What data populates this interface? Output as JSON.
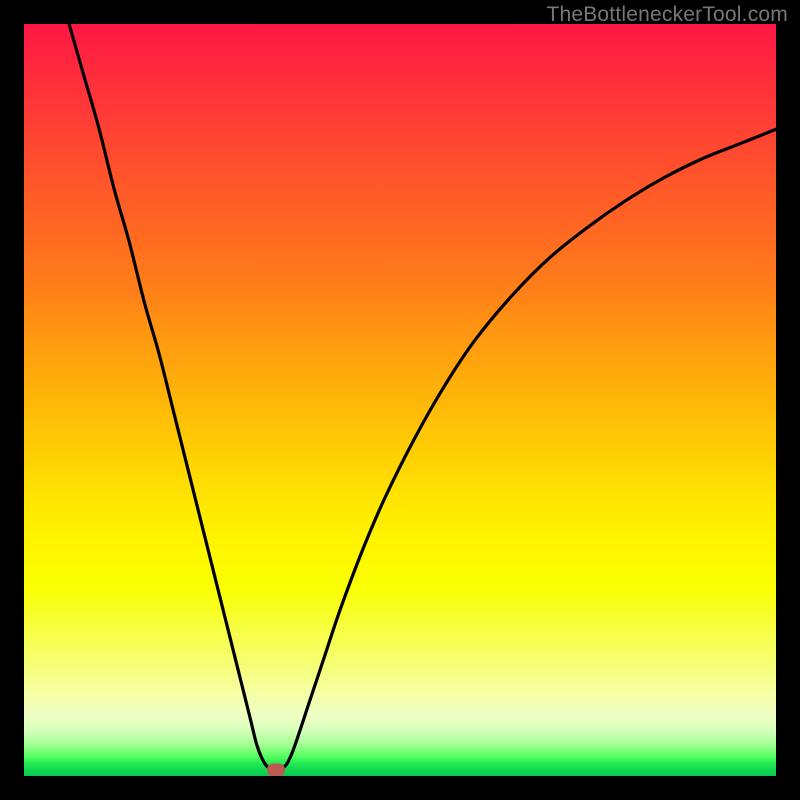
{
  "watermark": "TheBottleneckerTool.com",
  "colors": {
    "frame": "#000000",
    "curve": "#000000",
    "marker": "#bb5b4e",
    "gradient_top": "#ff1744",
    "gradient_bottom": "#07c84e"
  },
  "chart_data": {
    "type": "line",
    "title": "",
    "xlabel": "",
    "ylabel": "",
    "xlim": [
      0,
      100
    ],
    "ylim": [
      0,
      100
    ],
    "grid": false,
    "series": [
      {
        "name": "bottleneck-curve",
        "x": [
          6,
          8,
          10,
          12,
          14,
          16,
          18,
          20,
          22,
          24,
          26,
          28,
          30,
          31,
          32,
          33,
          34,
          35,
          36,
          38,
          40,
          42,
          45,
          48,
          52,
          56,
          60,
          65,
          70,
          75,
          80,
          85,
          90,
          95,
          100
        ],
        "values": [
          100,
          93,
          86,
          78,
          71,
          63,
          56,
          48,
          40,
          32,
          24,
          16,
          8,
          4,
          1.7,
          0.8,
          0.8,
          1.7,
          4,
          10,
          16,
          22,
          30,
          37,
          45,
          52,
          58,
          64,
          69,
          73,
          76.5,
          79.5,
          82,
          84,
          86
        ]
      }
    ],
    "annotations": [
      {
        "name": "optimum-marker",
        "x": 33.5,
        "y": 0.8
      }
    ]
  }
}
